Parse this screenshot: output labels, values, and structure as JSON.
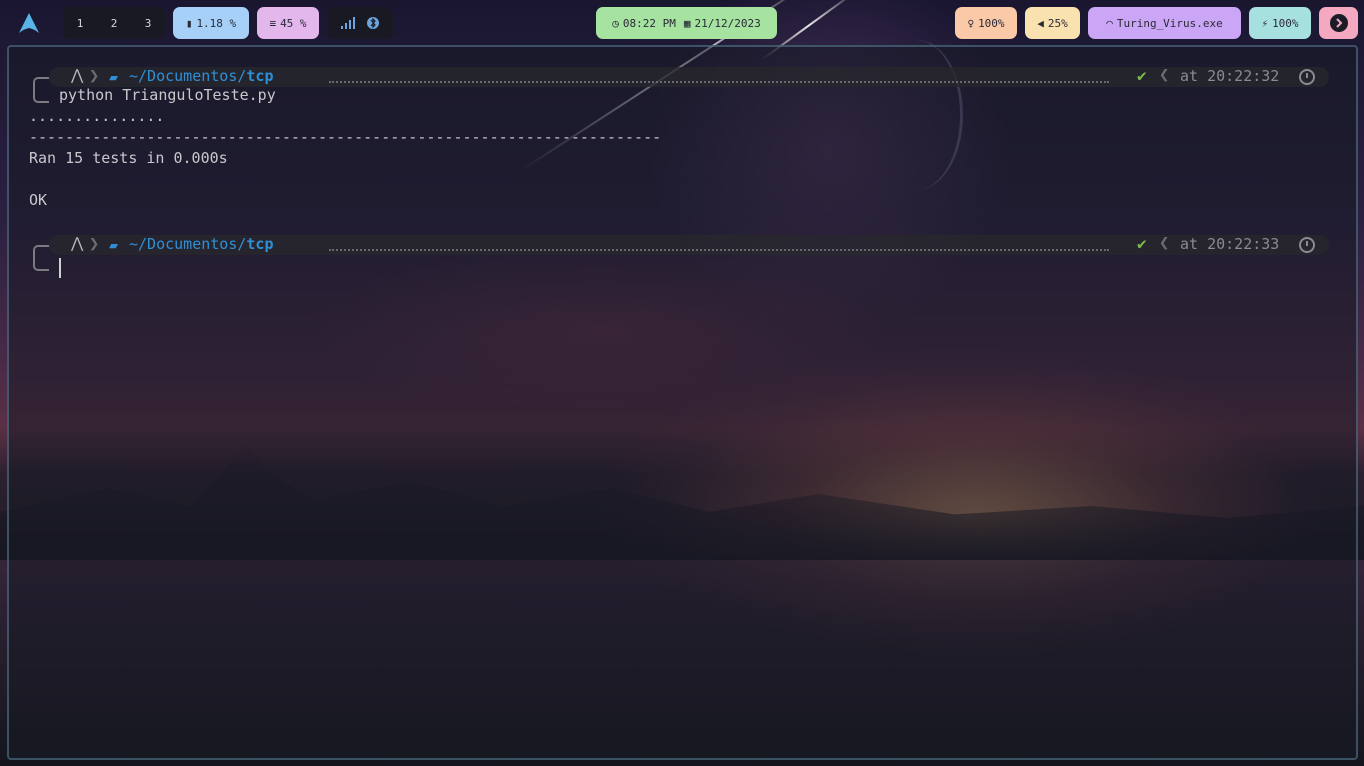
{
  "topbar": {
    "workspaces": [
      "1",
      "2",
      "3"
    ],
    "cpu": "1.18 %",
    "memory": "45 %",
    "clock": "08:22 PM",
    "date": "21/12/2023",
    "brightness": "100%",
    "volume": "25%",
    "wifi": "Turing_Virus.exe",
    "battery": "100%",
    "colors": {
      "cpu_bg": "#a6d0f7",
      "memory_bg": "#e3b6ec",
      "clock_bg": "#a6e3a1",
      "brightness_bg": "#f9c9a8",
      "volume_bg": "#f9e2af",
      "wifi_bg": "#cba6f7",
      "battery_bg": "#a6e1e0",
      "power_bg": "#f5a9c0"
    }
  },
  "terminal": {
    "prompts": [
      {
        "path_prefix": "~/Documentos/",
        "path_dir": "tcp",
        "status": "✔",
        "time": "at 20:22:32"
      },
      {
        "path_prefix": "~/Documentos/",
        "path_dir": "tcp",
        "status": "✔",
        "time": "at 20:22:33"
      }
    ],
    "command": "python TrianguloTeste.py",
    "output": {
      "dots": "...............",
      "separator": "----------------------------------------------------------------------",
      "ran": "Ran 15 tests in 0.000s",
      "result": "OK"
    }
  }
}
